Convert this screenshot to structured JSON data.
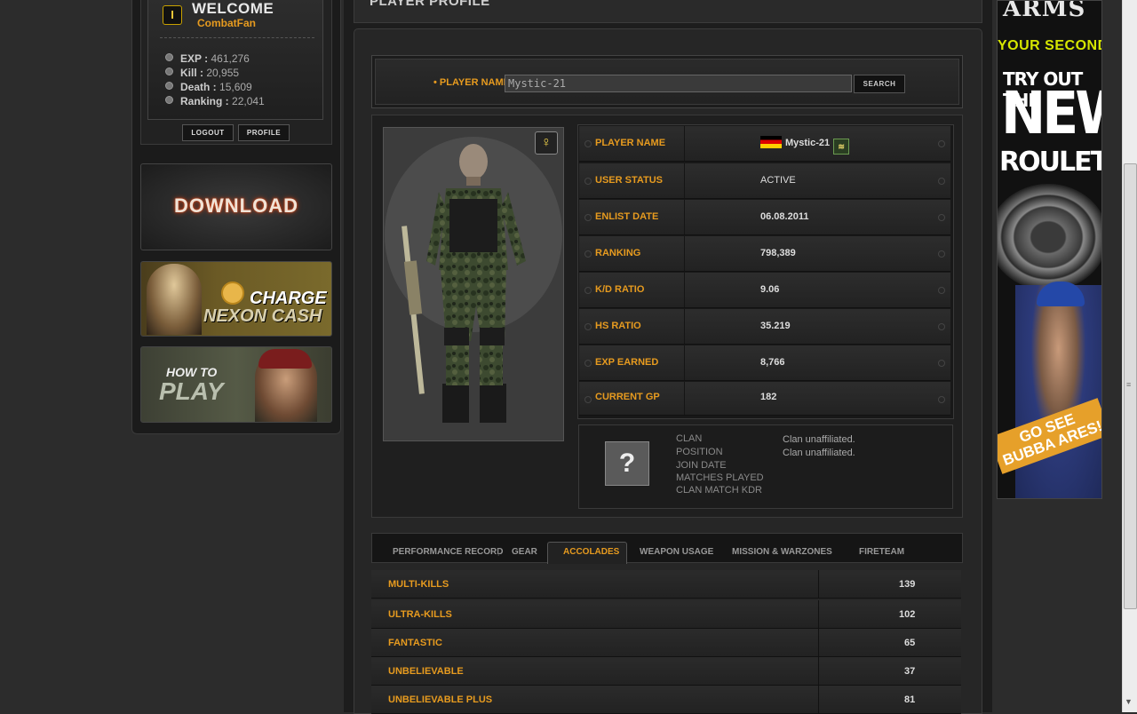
{
  "sidebar": {
    "welcome_title": "WELCOME",
    "username": "CombatFan",
    "coin_glyph": "I",
    "stats": [
      {
        "label": "EXP :",
        "value": "461,276"
      },
      {
        "label": "Kill :",
        "value": "20,955"
      },
      {
        "label": "Death :",
        "value": "15,609"
      },
      {
        "label": "Ranking :",
        "value": "22,041"
      }
    ],
    "logout_label": "LOGOUT",
    "profile_label": "PROFILE",
    "download_label": "DOWNLOAD",
    "charge_line1": "CHARGE",
    "charge_line2": "NEXON CASH",
    "howto_line1": "HOW TO",
    "howto_line2": "PLAY"
  },
  "main": {
    "title": "PLAYER PROFILE",
    "search": {
      "label": "• PLAYER NAME",
      "value": "Mystic-21",
      "button": "SEARCH"
    },
    "gender_glyph": "♀",
    "profile_rows": [
      {
        "label": "PLAYER NAME",
        "value": "Mystic-21"
      },
      {
        "label": "USER STATUS",
        "value": "ACTIVE"
      },
      {
        "label": "ENLIST DATE",
        "value": "06.08.2011"
      },
      {
        "label": "RANKING",
        "value": "798,389"
      },
      {
        "label": "K/D RATIO",
        "value": "9.06"
      },
      {
        "label": "HS RATIO",
        "value": "35.219"
      },
      {
        "label": "EXP EARNED",
        "value": "8,766"
      },
      {
        "label": "CURRENT GP",
        "value": "182"
      }
    ],
    "clan": {
      "icon_glyph": "?",
      "labels": [
        "CLAN",
        "POSITION",
        "JOIN DATE",
        "MATCHES PLAYED",
        "CLAN MATCH KDR"
      ],
      "values": [
        "Clan unaffiliated.",
        "Clan unaffiliated."
      ]
    },
    "tabs": [
      {
        "label": "PERFORMANCE RECORD"
      },
      {
        "label": "GEAR"
      },
      {
        "label": "ACCOLADES"
      },
      {
        "label": "WEAPON USAGE"
      },
      {
        "label": "MISSION & WARZONES"
      },
      {
        "label": "FIRETEAM"
      }
    ],
    "tab_separator": "|",
    "accolades": [
      {
        "label": "MULTI-KILLS",
        "value": "139"
      },
      {
        "label": "ULTRA-KILLS",
        "value": "102"
      },
      {
        "label": "FANTASTIC",
        "value": "65"
      },
      {
        "label": "UNBELIEVABLE",
        "value": "37"
      },
      {
        "label": "UNBELIEVABLE PLUS",
        "value": "81"
      }
    ]
  },
  "ad": {
    "brand": "ARMS",
    "line1": "YOUR SECOND",
    "line2": "TRY OUT THE",
    "line3": "NEW",
    "line4": "ROULETTE",
    "line5": "GO SEE BUBBA ARES!"
  },
  "colors": {
    "accent": "#e79b1f",
    "background": "#2c2c2c",
    "panel": "#1d1d1d"
  }
}
